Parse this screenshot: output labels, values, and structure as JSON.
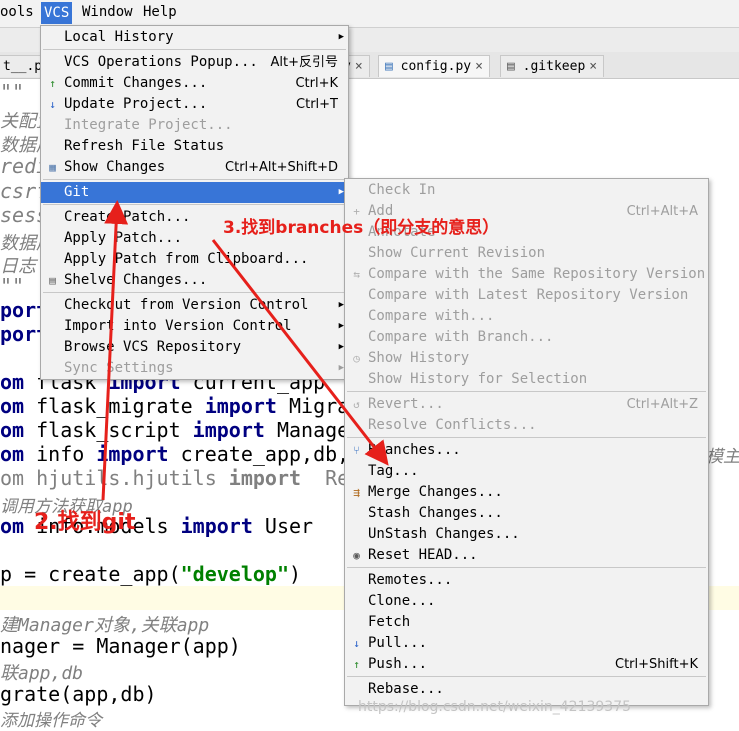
{
  "menubar": {
    "items": [
      "ools",
      "VCS",
      "Window",
      "Help"
    ]
  },
  "tabs": [
    {
      "label": "t__.py",
      "close": "×"
    },
    {
      "label": "y",
      "close": "×"
    },
    {
      "label": "config.py",
      "close": "×"
    },
    {
      "label": ".gitkeep",
      "close": "×"
    }
  ],
  "code": {
    "lines": [
      {
        "t": "\"\"",
        "cls": "c-comment"
      },
      {
        "t": "关配置",
        "cls": "c-comment"
      },
      {
        "t": "数据库",
        "cls": "c-comment"
      },
      {
        "t": "redis",
        "cls": "c-comment"
      },
      {
        "t": "csrf",
        "cls": "c-comment"
      },
      {
        "t": "sessi",
        "cls": "c-comment"
      },
      {
        "t": "数据库",
        "cls": "c-comment"
      },
      {
        "t": "日志",
        "cls": "c-comment"
      },
      {
        "t": "\"\"",
        "cls": "c-comment"
      },
      {
        "t": "port",
        "cls": "c-kw"
      },
      {
        "t": "port",
        "cls": "c-kw"
      }
    ],
    "import_lines": [
      {
        "kw1": "om",
        "mod": " flask ",
        "kw2": "import",
        "rest": " current_app"
      },
      {
        "kw1": "om",
        "mod": " flask_migrate ",
        "kw2": "import",
        "rest": " Migra"
      },
      {
        "kw1": "om",
        "mod": " flask_script ",
        "kw2": "import",
        "rest": " Manage"
      },
      {
        "kw1": "om",
        "mod": " info ",
        "kw2": "import",
        "rest": " create_app,db,"
      }
    ],
    "faded_import": {
      "kw1": "om",
      "mod": " hjutils.hjutils ",
      "kw2": "import",
      "rest": "  Re"
    },
    "comment_app": "调用方法获取app",
    "models_line": {
      "kw1": "om",
      "mod": " info.models ",
      "kw2": "import",
      "rest": " User"
    },
    "create_line": {
      "pre": "p = create_app(",
      "str": "\"develop\"",
      "post": ")"
    },
    "comment_manager": "建Manager对象,关联app",
    "manager_line": "nager = Manager(app)",
    "comment_db": "联app,db",
    "migrate_line": "grate(app,db)",
    "comment_cmd": "添加操作命令",
    "right_tail": "模主"
  },
  "vcs_menu": {
    "items": [
      {
        "label": "Local History",
        "arrow": true
      },
      {
        "sep": true
      },
      {
        "label": "VCS Operations Popup...",
        "shortcut": "Alt+反引号"
      },
      {
        "label": "Commit Changes...",
        "shortcut": "Ctrl+K",
        "icon": "commit-icon"
      },
      {
        "label": "Update Project...",
        "shortcut": "Ctrl+T",
        "icon": "update-icon"
      },
      {
        "label": "Integrate Project...",
        "disabled": true
      },
      {
        "label": "Refresh File Status"
      },
      {
        "label": "Show Changes",
        "shortcut": "Ctrl+Alt+Shift+D",
        "icon": "changes-icon"
      },
      {
        "sep": true
      },
      {
        "label": "Git",
        "arrow": true,
        "selected": true
      },
      {
        "sep": true
      },
      {
        "label": "Create Patch..."
      },
      {
        "label": "Apply Patch..."
      },
      {
        "label": "Apply Patch from Clipboard..."
      },
      {
        "label": "Shelve Changes...",
        "icon": "shelve-icon"
      },
      {
        "sep": true
      },
      {
        "label": "Checkout from Version Control",
        "arrow": true
      },
      {
        "label": "Import into Version Control",
        "arrow": true
      },
      {
        "label": "Browse VCS Repository",
        "arrow": true
      },
      {
        "label": "Sync Settings",
        "disabled": true,
        "arrow": true
      }
    ]
  },
  "git_menu": {
    "items": [
      {
        "label": "Check In",
        "disabled": true
      },
      {
        "label": "Add",
        "shortcut": "Ctrl+Alt+A",
        "disabled": true,
        "icon": "plus-icon"
      },
      {
        "label": "Annotate",
        "disabled": true
      },
      {
        "label": "Show Current Revision",
        "disabled": true
      },
      {
        "label": "Compare with the Same Repository Version",
        "disabled": true,
        "icon": "compare-icon"
      },
      {
        "label": "Compare with Latest Repository Version",
        "disabled": true
      },
      {
        "label": "Compare with...",
        "disabled": true
      },
      {
        "label": "Compare with Branch...",
        "disabled": true
      },
      {
        "label": "Show History",
        "disabled": true,
        "icon": "history-icon"
      },
      {
        "label": "Show History for Selection",
        "disabled": true
      },
      {
        "sep": true
      },
      {
        "label": "Revert...",
        "shortcut": "Ctrl+Alt+Z",
        "disabled": true,
        "icon": "revert-icon"
      },
      {
        "label": "Resolve Conflicts...",
        "disabled": true
      },
      {
        "sep": true
      },
      {
        "label": "Branches...",
        "icon": "branch-icon"
      },
      {
        "label": "Tag..."
      },
      {
        "label": "Merge Changes...",
        "icon": "merge-icon"
      },
      {
        "label": "Stash Changes..."
      },
      {
        "label": "UnStash Changes..."
      },
      {
        "label": "Reset HEAD...",
        "icon": "reset-icon"
      },
      {
        "sep": true
      },
      {
        "label": "Remotes..."
      },
      {
        "label": "Clone..."
      },
      {
        "label": "Fetch"
      },
      {
        "label": "Pull...",
        "icon": "pull-icon"
      },
      {
        "label": "Push...",
        "shortcut": "Ctrl+Shift+K",
        "icon": "push-icon"
      },
      {
        "sep": true
      },
      {
        "label": "Rebase..."
      }
    ]
  },
  "annotations": {
    "step2": "2.找到git",
    "step3": "3.找到branches（即分支的意思）"
  },
  "watermark": "https://blog.csdn.net/weixin_42139375",
  "colors": {
    "selection": "#3875d7",
    "annotation": "#e6201b",
    "keyword": "#000080",
    "string": "#008000"
  }
}
